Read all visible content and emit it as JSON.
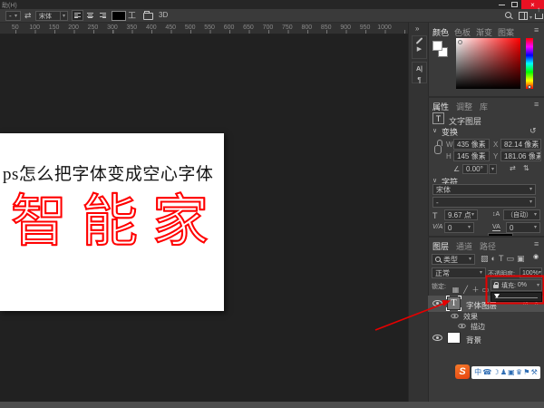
{
  "colors": {
    "close_red": "#e81123",
    "annotation_red": "#e60000",
    "stroke_red": "#ff0000",
    "watermark_orange": "#e8430f",
    "icon_blue": "#2e6db4",
    "selected_layer_bg": "#505050"
  },
  "window": {
    "menu_text": "助(H)"
  },
  "options_bar": {
    "preset": "-",
    "font": "宋体",
    "threed": "3D"
  },
  "ruler": {
    "labels": [
      "50",
      "100",
      "150",
      "200",
      "250",
      "300",
      "350",
      "400",
      "450",
      "500",
      "550",
      "600",
      "650",
      "700",
      "750",
      "800",
      "850",
      "900",
      "950",
      "1000"
    ]
  },
  "doc": {
    "title": "ps怎么把字体变成空心字体",
    "hollow": "智能家"
  },
  "color_panel": {
    "tabs": [
      "颜色",
      "色板",
      "渐变",
      "图案"
    ]
  },
  "properties": {
    "tabs": [
      "属性",
      "调整",
      "库"
    ],
    "layer_type_label": "文字图层",
    "transform_title": "变换",
    "w_label": "W",
    "w_value": "435 像素",
    "x_label": "X",
    "x_value": "82.14 像素",
    "h_label": "H",
    "h_value": "145 像素",
    "y_label": "Y",
    "y_value": "181.06 像素",
    "angle_value": "0.00°",
    "char_title": "字符",
    "font_value": "宋体",
    "style_value": "-",
    "size_value": "9.67 点",
    "leading_value": "（自动）",
    "kerning_value": "0",
    "tracking_value": "0"
  },
  "layers": {
    "tabs": [
      "图层",
      "通道",
      "路径"
    ],
    "filter_label": "类型",
    "blend_mode": "正常",
    "opacity_label": "不透明度:",
    "opacity_value": "100%",
    "lock_label": "锁定:",
    "fill_label": "填充:",
    "fill_value": "0%",
    "fx_label": "fx",
    "rows": {
      "text_layer": "字体图层",
      "effects": "效果",
      "stroke": "描边",
      "background": "背景"
    }
  },
  "watermark": {
    "logo": "S",
    "icons": [
      "中",
      "☎",
      "☽",
      "♟",
      "▣",
      "♛",
      "⚑",
      "⚒"
    ]
  },
  "icons": {
    "caret": "▾",
    "menu": "≡",
    "collapse": "»",
    "section_caret": "∨",
    "reset": "↺",
    "angle": "∠",
    "flip_h": "⇄",
    "flip_v": "⇅",
    "orientation": "⇄",
    "warp": "工",
    "play": "▶",
    "character": "A|",
    "paragraph": "¶",
    "t": "T",
    "size_icon": "T",
    "leading_icon": "↕A",
    "kerning_icon": "V/A",
    "tracking_icon": "VA",
    "close": "×",
    "pin": "◉",
    "fx_caret": "∧",
    "lock_row": [
      "▦",
      "╱",
      "＋",
      "▭"
    ],
    "filter_row": [
      "▨",
      "◐",
      "T",
      "▭",
      "▣"
    ]
  }
}
